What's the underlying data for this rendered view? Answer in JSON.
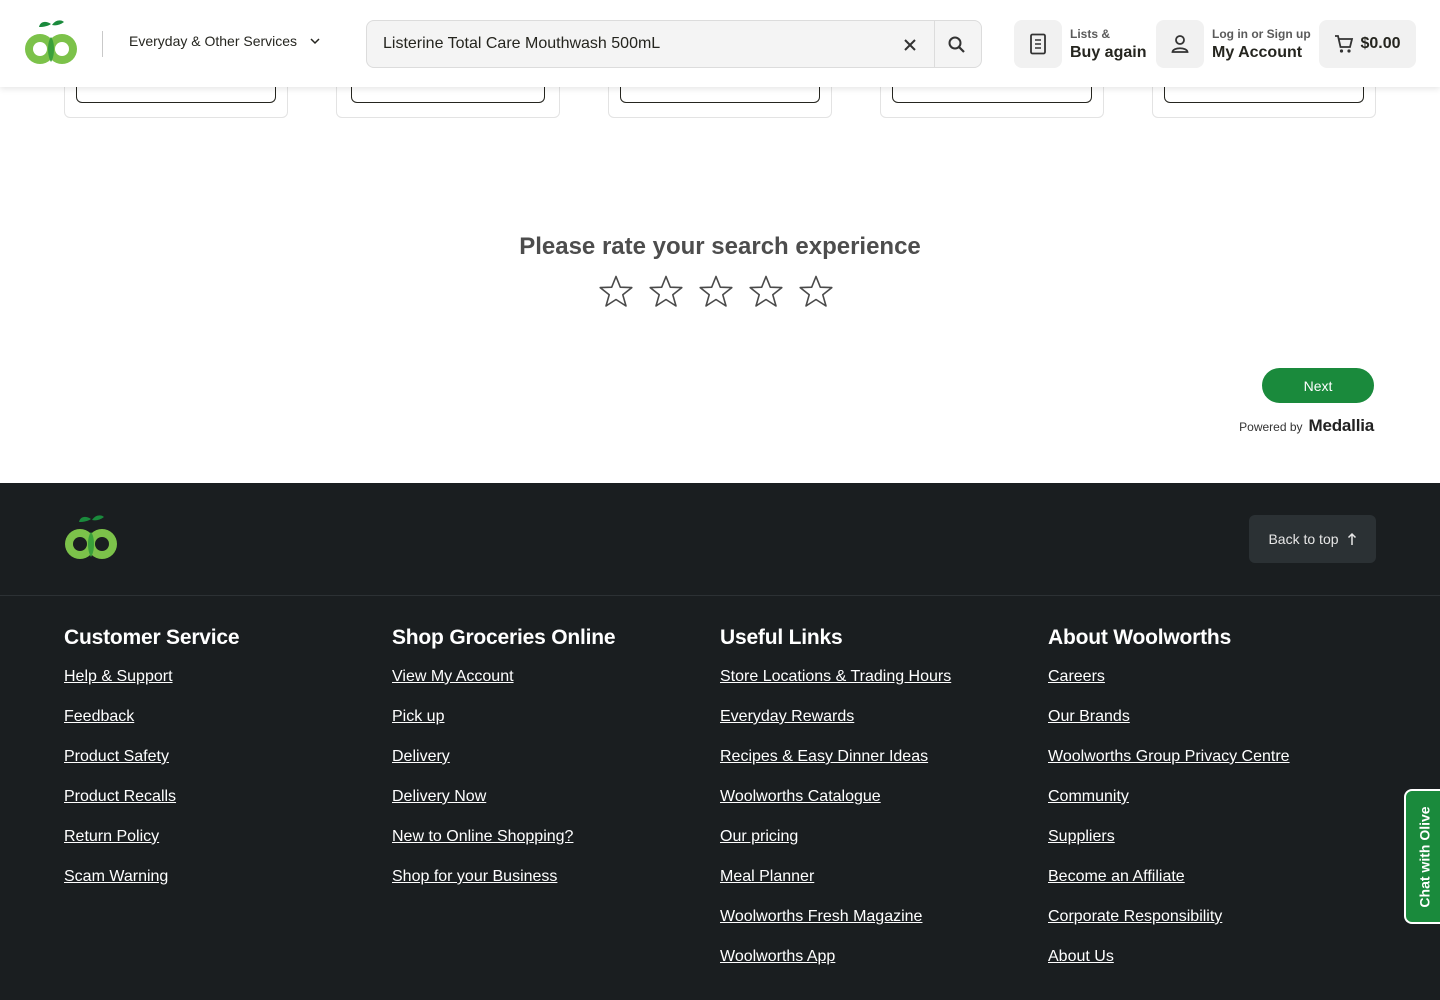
{
  "header": {
    "services_label": "Everyday & Other Services",
    "search_value": "Listerine Total Care Mouthwash 500mL",
    "lists_small": "Lists &",
    "lists_big": "Buy again",
    "account_small": "Log in or Sign up",
    "account_big": "My Account",
    "cart_total": "$0.00"
  },
  "survey": {
    "title": "Please rate your search experience",
    "star_count": 5,
    "next_label": "Next",
    "powered_by": "Powered by",
    "powered_brand": "Medallia"
  },
  "footer": {
    "back_to_top": "Back to top",
    "columns": [
      {
        "title": "Customer Service",
        "links": [
          "Help & Support",
          "Feedback",
          "Product Safety",
          "Product Recalls",
          "Return Policy",
          "Scam Warning"
        ]
      },
      {
        "title": "Shop Groceries Online",
        "links": [
          "View My Account",
          "Pick up",
          "Delivery",
          "Delivery Now",
          "New to Online Shopping?",
          "Shop for your Business"
        ]
      },
      {
        "title": "Useful Links",
        "links": [
          "Store Locations & Trading Hours",
          "Everyday Rewards",
          "Recipes & Easy Dinner Ideas",
          "Woolworths Catalogue",
          "Our pricing",
          "Meal Planner",
          "Woolworths Fresh Magazine",
          "Woolworths App"
        ]
      },
      {
        "title": "About Woolworths",
        "links": [
          "Careers",
          "Our Brands",
          "Woolworths Group Privacy Centre",
          "Community",
          "Suppliers",
          "Become an Affiliate",
          "Corporate Responsibility",
          "About Us"
        ]
      }
    ]
  },
  "chat_label": "Chat with Olive",
  "colors": {
    "brand_green": "#1a8a3c",
    "logo_light_green": "#7cc24a",
    "footer_bg": "#1a1e20"
  },
  "icons": [
    "woolworths-logo",
    "chevron-down-icon",
    "close-icon",
    "search-icon",
    "list-icon",
    "user-icon",
    "cart-icon",
    "star-outline-icon",
    "arrow-up-icon"
  ]
}
